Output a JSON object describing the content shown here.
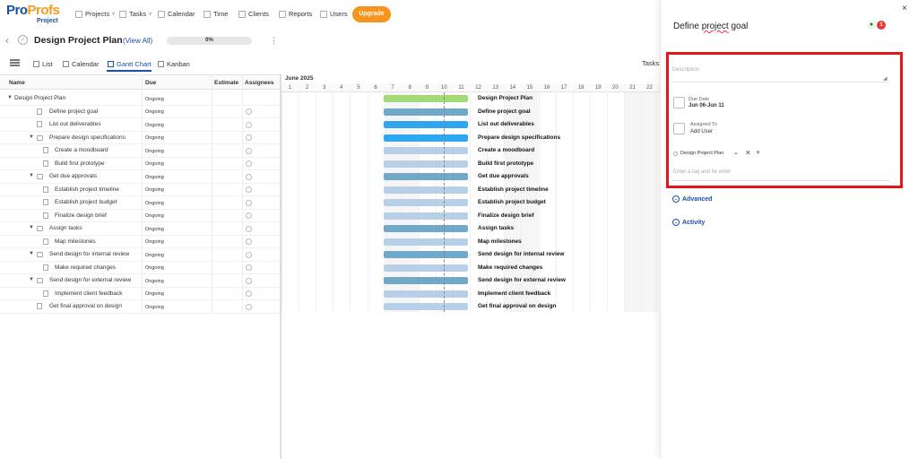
{
  "brand": {
    "logo_main": "Pro",
    "logo_accent": "Profs",
    "logo_sub": "Project"
  },
  "nav": {
    "items": [
      {
        "label": "Projects",
        "icon": "folder-icon",
        "caret": "˅"
      },
      {
        "label": "Tasks",
        "icon": "checkbox-icon",
        "caret": "˅"
      },
      {
        "label": "Calendar",
        "icon": "calendar-icon",
        "caret": ""
      },
      {
        "label": "Time",
        "icon": "clock-icon",
        "caret": ""
      },
      {
        "label": "Clients",
        "icon": "person-icon",
        "caret": ""
      },
      {
        "label": "Reports",
        "icon": "chart-icon",
        "caret": ""
      },
      {
        "label": "Users",
        "icon": "users-icon",
        "caret": ""
      }
    ],
    "upgrade_label": "Upgrade"
  },
  "project": {
    "title": "Design Project Plan",
    "view_all": "(View All)",
    "progress_label": "0%",
    "progress_value": 0
  },
  "views": {
    "list": "List",
    "calendar": "Calendar",
    "gantt": "Gantt Chart",
    "kanban": "Kanban",
    "tasks_label": "Tasks:"
  },
  "grid": {
    "headers": {
      "name": "Name",
      "due": "Due",
      "estimate": "Estimate",
      "assignees": "Assignees"
    },
    "rows": [
      {
        "name": "Design Project Plan",
        "status": "Ongoing",
        "level": 0,
        "kind": "root",
        "expanded": true
      },
      {
        "name": "Define project goal",
        "status": "Ongoing",
        "level": 1,
        "kind": "doc"
      },
      {
        "name": "List out deliverables",
        "status": "Ongoing",
        "level": 1,
        "kind": "doc"
      },
      {
        "name": "Prepare design specifications",
        "status": "Ongoing",
        "level": 1,
        "kind": "folder",
        "expanded": true
      },
      {
        "name": "Create a moodboard",
        "status": "Ongoing",
        "level": 2,
        "kind": "doc"
      },
      {
        "name": "Build first prototype",
        "status": "Ongoing",
        "level": 2,
        "kind": "doc"
      },
      {
        "name": "Get due approvals",
        "status": "Ongoing",
        "level": 1,
        "kind": "folder",
        "expanded": true
      },
      {
        "name": "Establish project timeline",
        "status": "Ongoing",
        "level": 2,
        "kind": "doc"
      },
      {
        "name": "Establish project budget",
        "status": "Ongoing",
        "level": 2,
        "kind": "doc"
      },
      {
        "name": "Finalize design brief",
        "status": "Ongoing",
        "level": 2,
        "kind": "doc"
      },
      {
        "name": "Assign tasks",
        "status": "Ongoing",
        "level": 1,
        "kind": "folder",
        "expanded": true
      },
      {
        "name": "Map milestones",
        "status": "Ongoing",
        "level": 2,
        "kind": "doc"
      },
      {
        "name": "Send design for internal review",
        "status": "Ongoing",
        "level": 1,
        "kind": "folder",
        "expanded": true
      },
      {
        "name": "Make required changes",
        "status": "Ongoing",
        "level": 2,
        "kind": "doc"
      },
      {
        "name": "Send design for external review",
        "status": "Ongoing",
        "level": 1,
        "kind": "folder",
        "expanded": true
      },
      {
        "name": "Implement client feedback",
        "status": "Ongoing",
        "level": 2,
        "kind": "doc"
      },
      {
        "name": "Get final approval on design",
        "status": "Ongoing",
        "level": 1,
        "kind": "doc"
      }
    ]
  },
  "gantt": {
    "month": "June 2025",
    "days": [
      "1",
      "2",
      "3",
      "4",
      "5",
      "6",
      "7",
      "8",
      "9",
      "10",
      "11",
      "12",
      "13",
      "14",
      "15",
      "16",
      "17",
      "18",
      "19",
      "20",
      "21",
      "22"
    ],
    "weekend_days": [
      "7",
      "8",
      "14",
      "15",
      "21",
      "22"
    ],
    "today_day": 10,
    "bar_start_day": 6,
    "bar_end_day": 11,
    "bar_colors": {
      "root": "#a3d977",
      "folder": "#6fa8c9",
      "doc_1": "#2ea6f1",
      "doc_2": "#b8cfe8"
    }
  },
  "panel": {
    "close": "×",
    "title_pre": "Define ",
    "title_underlined": "project",
    "title_post": " goal",
    "alerts_count": "1",
    "description_placeholder": "Description",
    "due_label": "Due Date",
    "due_value": "Jun 06-Jun 11",
    "assigned_label": "Assigned To",
    "assigned_value": "Add User",
    "project_value": "Design Project Plan",
    "tag_placeholder": "Enter a tag and hit enter",
    "advanced": "Advanced",
    "activity": "Activity"
  },
  "colors": {
    "brand": "#1b4fa3",
    "accent": "#f7941d",
    "highlight_box": "#e3161b"
  }
}
